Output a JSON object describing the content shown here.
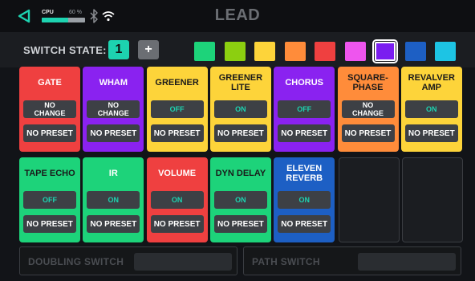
{
  "header": {
    "title": "LEAD",
    "cpu_label": "CPU",
    "cpu_percent": "60 %",
    "cpu_level": 0.62,
    "back_icon": "back-triangle-icon",
    "bluetooth_icon": "bluetooth-icon",
    "wifi_icon": "wifi-icon"
  },
  "switch_state": {
    "label": "SWITCH STATE:",
    "number": "1",
    "add": "+",
    "swatches": [
      {
        "color": "#1dd37a",
        "selected": false
      },
      {
        "color": "#8ccf10",
        "selected": false
      },
      {
        "color": "#fdd43a",
        "selected": false
      },
      {
        "color": "#ff8c3a",
        "selected": false
      },
      {
        "color": "#ef4040",
        "selected": false
      },
      {
        "color": "#ee55ee",
        "selected": false
      },
      {
        "color": "#7a1df0",
        "selected": true
      },
      {
        "color": "#1d5fc4",
        "selected": false
      },
      {
        "color": "#1dc4e4",
        "selected": false
      }
    ]
  },
  "tiles": [
    {
      "name": "GATE",
      "state": "NO\nCHANGE",
      "preset": "NO PRESET",
      "color": "#ef4040",
      "text_color": "#ffffff",
      "state_color": "#ffffff"
    },
    {
      "name": "WHAM",
      "state": "NO\nCHANGE",
      "preset": "NO PRESET",
      "color": "#8a22f0",
      "text_color": "#ffffff",
      "state_color": "#ffffff"
    },
    {
      "name": "GREENER",
      "state": "OFF",
      "preset": "NO PRESET",
      "color": "#fdd43a",
      "text_color": "#1a1a1a",
      "state_color": "#1dd3b0"
    },
    {
      "name": "GREENER\nLITE",
      "state": "ON",
      "preset": "NO PRESET",
      "color": "#fdd43a",
      "text_color": "#1a1a1a",
      "state_color": "#1dd3b0"
    },
    {
      "name": "CHORUS",
      "state": "OFF",
      "preset": "NO PRESET",
      "color": "#8a22f0",
      "text_color": "#ffffff",
      "state_color": "#1dd3b0"
    },
    {
      "name": "SQUARE-\nPHASE",
      "state": "NO\nCHANGE",
      "preset": "NO PRESET",
      "color": "#ff8c3a",
      "text_color": "#1a1a1a",
      "state_color": "#ffffff"
    },
    {
      "name": "REVALVER\nAMP",
      "state": "ON",
      "preset": "NO PRESET",
      "color": "#fdd43a",
      "text_color": "#1a1a1a",
      "state_color": "#1dd3b0"
    },
    {
      "name": "TAPE ECHO",
      "state": "OFF",
      "preset": "NO PRESET",
      "color": "#1dd37a",
      "text_color": "#1a1a1a",
      "state_color": "#1dd3b0"
    },
    {
      "name": "IR",
      "state": "ON",
      "preset": "NO PRESET",
      "color": "#1dd37a",
      "text_color": "#ffffff",
      "state_color": "#1dd3b0"
    },
    {
      "name": "VOLUME",
      "state": "ON",
      "preset": "NO PRESET",
      "color": "#ef4040",
      "text_color": "#ffffff",
      "state_color": "#1dd3b0"
    },
    {
      "name": "DYN DELAY",
      "state": "ON",
      "preset": "NO PRESET",
      "color": "#1dd37a",
      "text_color": "#1a1a1a",
      "state_color": "#1dd3b0"
    },
    {
      "name": "ELEVEN\nREVERB",
      "state": "ON",
      "preset": "NO PRESET",
      "color": "#1d5fc4",
      "text_color": "#ffffff",
      "state_color": "#1dd3b0"
    }
  ],
  "bottom": {
    "doubling_label": "DOUBLING SWITCH",
    "path_label": "PATH SWITCH"
  }
}
